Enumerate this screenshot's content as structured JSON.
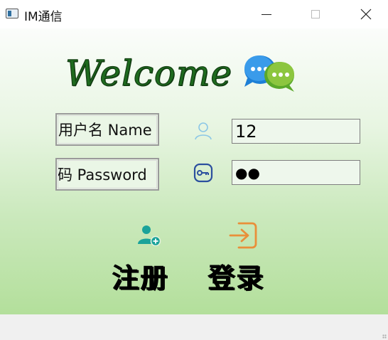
{
  "window": {
    "title": "IM通信"
  },
  "welcome": {
    "text": "Welcome"
  },
  "form": {
    "name_label": "用户名 Name",
    "password_label": "密码 Password",
    "name_value": "12",
    "password_value": "●●"
  },
  "actions": {
    "register_label": "注册",
    "login_label": "登录"
  },
  "icons": {
    "app": "app-window-icon",
    "chat": "chat-bubbles-icon",
    "user": "user-icon",
    "password": "key-icon",
    "register": "add-user-icon",
    "login": "login-arrow-icon"
  },
  "colors": {
    "gradient_top": "#fbfdfb",
    "gradient_bottom": "#b3df9b",
    "welcome_text": "#1e6b1e",
    "login_icon": "#e98f3a",
    "register_icon": "#1aa39a"
  }
}
